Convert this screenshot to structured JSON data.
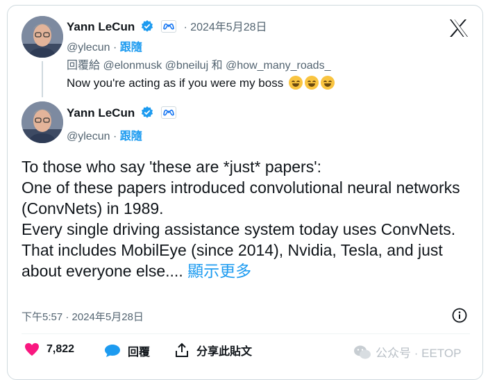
{
  "reply": {
    "author_name": "Yann LeCun",
    "date": "· 2024年5月28日",
    "handle": "@ylecun",
    "separator": "·",
    "follow_label": "跟隨",
    "reply_to_prefix": "回覆給",
    "reply_to_users": "@elonmusk @bneiluj 和 @how_many_roads_",
    "text": "Now you're acting as if you were my boss"
  },
  "main": {
    "author_name": "Yann LeCun",
    "handle": "@ylecun",
    "separator": "·",
    "follow_label": "跟隨",
    "text": "To those who say 'these are *just* papers':\nOne of these papers introduced convolutional neural networks (ConvNets) in 1989.\nEvery single driving assistance system today uses ConvNets.\nThat includes MobilEye (since 2014), Nvidia, Tesla, and just about everyone else.... ",
    "show_more": "顯示更多",
    "timestamp": "下午5:57 · 2024年5月28日"
  },
  "actions": {
    "likes": "7,822",
    "reply_label": "回覆",
    "share_label": "分享此貼文"
  },
  "watermark": "公众号 · EETOP",
  "colors": {
    "accent": "#1d9bf0",
    "like": "#f91880",
    "text": "#0f1419",
    "muted": "#536471"
  }
}
